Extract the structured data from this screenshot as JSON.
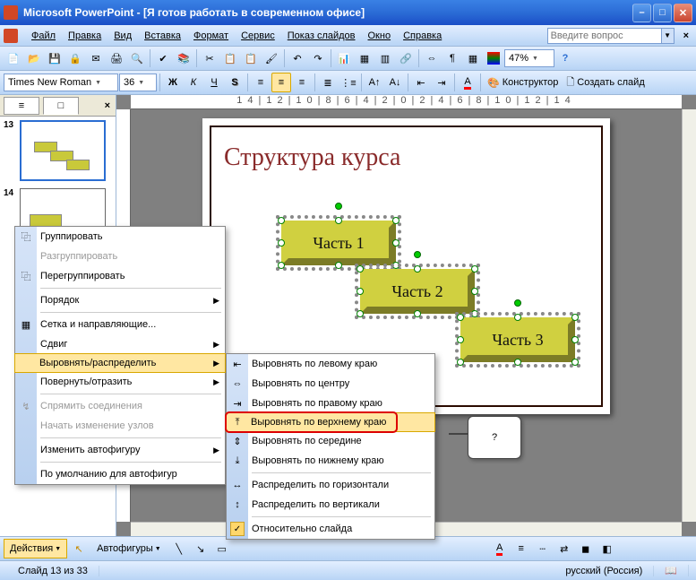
{
  "title": "Microsoft PowerPoint - [Я готов работать в современном офисе]",
  "menu": {
    "file": "Файл",
    "edit": "Правка",
    "view": "Вид",
    "insert": "Вставка",
    "format": "Формат",
    "service": "Сервис",
    "slideshow": "Показ слайдов",
    "window": "Окно",
    "help": "Справка",
    "help_placeholder": "Введите вопрос"
  },
  "toolbar": {
    "font": "Times New Roman",
    "size": "36",
    "zoom": "47%",
    "designer": "Конструктор",
    "new_slide": "Создать слайд"
  },
  "thumbs": {
    "n13": "13",
    "n14": "14"
  },
  "slide": {
    "title": "Структура курса",
    "part1": "Часть 1",
    "part2": "Часть 2",
    "part3": "Часть 3"
  },
  "ruler": "14|12|10|8|6|4|2|0|2|4|6|8|10|12|14",
  "context": {
    "group": "Группировать",
    "ungroup": "Разгруппировать",
    "regroup": "Перегруппировать",
    "order": "Порядок",
    "grid": "Сетка и направляющие...",
    "nudge": "Сдвиг",
    "align": "Выровнять/распределить",
    "rotate": "Повернуть/отразить",
    "reroute": "Спрямить соединения",
    "edit_points": "Начать изменение узлов",
    "change_shape": "Изменить автофигуру",
    "defaults": "По умолчанию для автофигур"
  },
  "submenu": {
    "left": "Выровнять по левому краю",
    "center_h": "Выровнять по центру",
    "right": "Выровнять по правому краю",
    "top": "Выровнять по верхнему краю",
    "middle": "Выровнять по середине",
    "bottom": "Выровнять по нижнему краю",
    "dist_h": "Распределить по горизонтали",
    "dist_v": "Распределить по вертикали",
    "rel_slide": "Относительно слайда"
  },
  "callout": "?",
  "drawbar": {
    "actions": "Действия",
    "autoshapes": "Автофигуры"
  },
  "status": {
    "slide": "Слайд 13 из 33",
    "lang": "русский (Россия)"
  }
}
